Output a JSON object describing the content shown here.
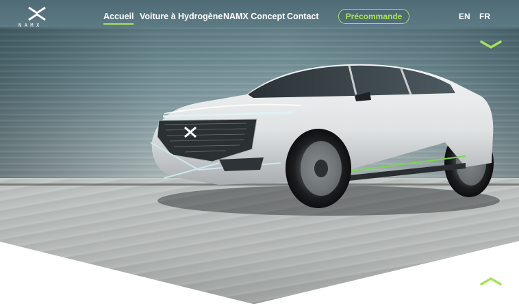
{
  "brand": {
    "logo_word": "NAMX",
    "accent_color": "#a6e35a"
  },
  "nav": {
    "items": [
      {
        "label": "Accueil",
        "active": true
      },
      {
        "label": "Voiture à Hydrogène",
        "active": false
      },
      {
        "label": "NAMX Concept",
        "active": false
      },
      {
        "label": "Contact",
        "active": false
      }
    ],
    "cta_label": "Précommande"
  },
  "languages": [
    "EN",
    "FR"
  ],
  "hero": {
    "image": "white NAMX hydrogen SUV on road",
    "controls": {
      "next_icon": "chevron-down-icon",
      "prev_icon": "chevron-up-icon"
    }
  }
}
